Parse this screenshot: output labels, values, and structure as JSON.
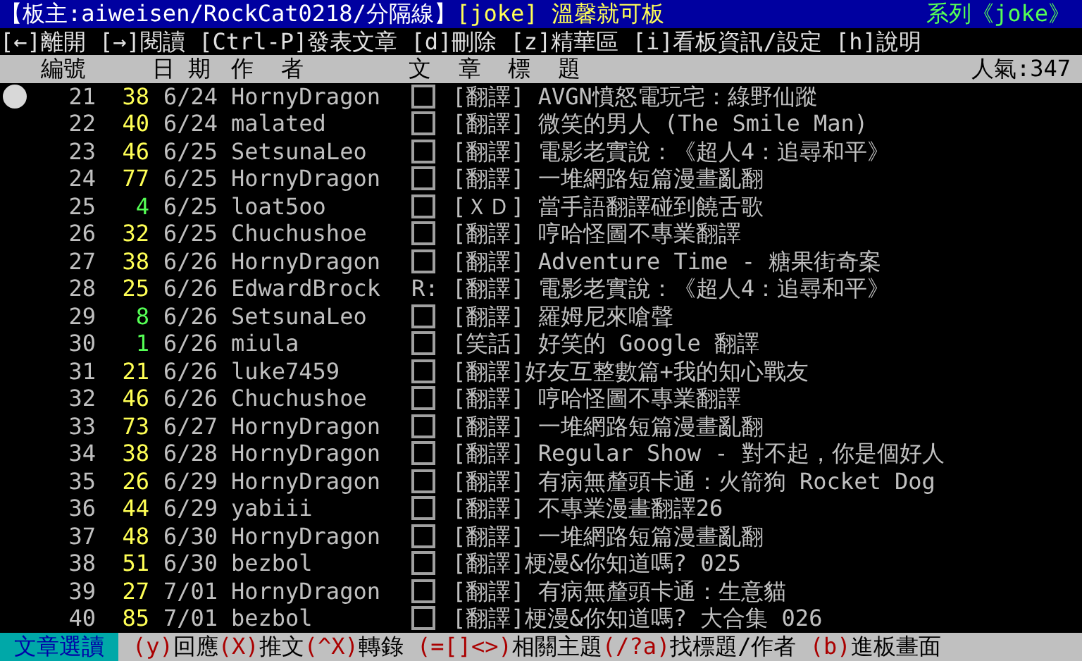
{
  "header": {
    "board_info": "【板主:aiweisen/RockCat0218/分隔線】",
    "board_name": "[joke] 溫馨就可板",
    "series": "系列《joke》"
  },
  "help_line": "[←]離開 [→]閱讀 [Ctrl-P]發表文章 [d]刪除 [z]精華區 [i]看板資訊/設定 [h]說明",
  "columns": {
    "number": "編號",
    "date": "日 期",
    "author": "作  者",
    "title": "文  章  標  題",
    "popularity": "人氣:347"
  },
  "rows": [
    {
      "number": "21",
      "push": "38",
      "color": "#ffff55",
      "date": "6/24",
      "author": "HornyDragon",
      "kind": "box",
      "title": "[翻譯] AVGN憤怒電玩宅：綠野仙蹤",
      "selected": true
    },
    {
      "number": "22",
      "push": "40",
      "color": "#ffff55",
      "date": "6/24",
      "author": "malated",
      "kind": "box",
      "title": "[翻譯] 微笑的男人 (The Smile Man)",
      "selected": false
    },
    {
      "number": "23",
      "push": "46",
      "color": "#ffff55",
      "date": "6/25",
      "author": "SetsunaLeo",
      "kind": "box",
      "title": "[翻譯] 電影老實說：《超人4：追尋和平》",
      "selected": false
    },
    {
      "number": "24",
      "push": "77",
      "color": "#ffff55",
      "date": "6/25",
      "author": "HornyDragon",
      "kind": "box",
      "title": "[翻譯] 一堆網路短篇漫畫亂翻",
      "selected": false
    },
    {
      "number": "25",
      "push": "4",
      "color": "#55ff55",
      "date": "6/25",
      "author": "loat5oo",
      "kind": "box",
      "title": "[ＸＤ] 當手語翻譯碰到饒舌歌",
      "selected": false
    },
    {
      "number": "26",
      "push": "32",
      "color": "#ffff55",
      "date": "6/25",
      "author": "Chuchushoe",
      "kind": "box",
      "title": "[翻譯] 哼哈怪圖不專業翻譯",
      "selected": false
    },
    {
      "number": "27",
      "push": "38",
      "color": "#ffff55",
      "date": "6/26",
      "author": "HornyDragon",
      "kind": "box",
      "title": "[翻譯] Adventure Time - 糖果街奇案",
      "selected": false
    },
    {
      "number": "28",
      "push": "25",
      "color": "#ffff55",
      "date": "6/26",
      "author": "EdwardBrock",
      "kind": "reply",
      "mark": "R:",
      "title": "[翻譯] 電影老實說：《超人4：追尋和平》",
      "selected": false
    },
    {
      "number": "29",
      "push": "8",
      "color": "#55ff55",
      "date": "6/26",
      "author": "SetsunaLeo",
      "kind": "box",
      "title": "[翻譯] 羅姆尼來嗆聲",
      "selected": false
    },
    {
      "number": "30",
      "push": "1",
      "color": "#55ff55",
      "date": "6/26",
      "author": "miula",
      "kind": "box",
      "title": "[笑話] 好笑的 Google 翻譯",
      "selected": false
    },
    {
      "number": "31",
      "push": "21",
      "color": "#ffff55",
      "date": "6/26",
      "author": "luke7459",
      "kind": "box",
      "title": "[翻譯]好友互整數篇+我的知心戰友",
      "selected": false
    },
    {
      "number": "32",
      "push": "46",
      "color": "#ffff55",
      "date": "6/26",
      "author": "Chuchushoe",
      "kind": "box",
      "title": "[翻譯] 哼哈怪圖不專業翻譯",
      "selected": false
    },
    {
      "number": "33",
      "push": "73",
      "color": "#ffff55",
      "date": "6/27",
      "author": "HornyDragon",
      "kind": "box",
      "title": "[翻譯] 一堆網路短篇漫畫亂翻",
      "selected": false
    },
    {
      "number": "34",
      "push": "38",
      "color": "#ffff55",
      "date": "6/28",
      "author": "HornyDragon",
      "kind": "box",
      "title": "[翻譯] Regular Show - 對不起，你是個好人",
      "selected": false
    },
    {
      "number": "35",
      "push": "26",
      "color": "#ffff55",
      "date": "6/29",
      "author": "HornyDragon",
      "kind": "box",
      "title": "[翻譯] 有病無釐頭卡通：火箭狗 Rocket Dog",
      "selected": false
    },
    {
      "number": "36",
      "push": "44",
      "color": "#ffff55",
      "date": "6/29",
      "author": "yabiii",
      "kind": "box",
      "title": "[翻譯] 不專業漫畫翻譯26",
      "selected": false
    },
    {
      "number": "37",
      "push": "48",
      "color": "#ffff55",
      "date": "6/30",
      "author": "HornyDragon",
      "kind": "box",
      "title": "[翻譯] 一堆網路短篇漫畫亂翻",
      "selected": false
    },
    {
      "number": "38",
      "push": "51",
      "color": "#ffff55",
      "date": "6/30",
      "author": "bezbol",
      "kind": "box",
      "title": "[翻譯]梗漫&你知道嗎? 025",
      "selected": false
    },
    {
      "number": "39",
      "push": "27",
      "color": "#ffff55",
      "date": "7/01",
      "author": "HornyDragon",
      "kind": "box",
      "title": "[翻譯] 有病無釐頭卡通：生意貓",
      "selected": false
    },
    {
      "number": "40",
      "push": "85",
      "color": "#ffff55",
      "date": "7/01",
      "author": "bezbol",
      "kind": "box",
      "title": "[翻譯]梗漫&你知道嗎? 大合集 026",
      "selected": false
    }
  ],
  "footer": {
    "mode": "文章選讀",
    "commands": [
      {
        "key": "(y)",
        "label": "回應"
      },
      {
        "key": "(X)",
        "label": "推文"
      },
      {
        "key": "(^X)",
        "label": "轉錄 "
      },
      {
        "key": "(=[]<>)",
        "label": "相關主題"
      },
      {
        "key": "(/?a)",
        "label": "找標題/作者 "
      },
      {
        "key": "(b)",
        "label": "進板畫面"
      }
    ]
  }
}
